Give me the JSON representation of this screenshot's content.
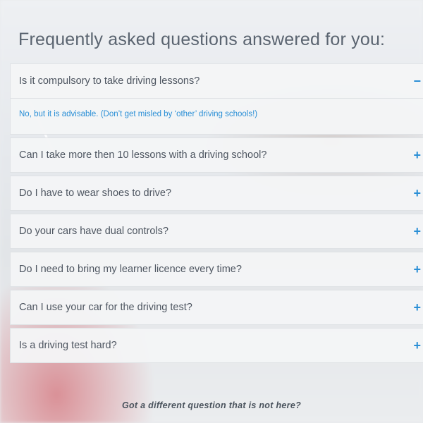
{
  "faq": {
    "title": "Frequently asked questions answered for you:",
    "items": [
      {
        "question": "Is it compulsory to take driving lessons?",
        "toggle": "−",
        "expanded": true,
        "answer": "No, but it is advisable. (Don’t get misled by ‘other’ driving schools!)"
      },
      {
        "question": "Can I take more then 10 lessons with a driving school?",
        "toggle": "+",
        "expanded": false
      },
      {
        "question": "Do I have to wear shoes to drive?",
        "toggle": "+",
        "expanded": false
      },
      {
        "question": "Do your cars have dual controls?",
        "toggle": "+",
        "expanded": false
      },
      {
        "question": "Do I need to bring my learner licence every time?",
        "toggle": "+",
        "expanded": false
      },
      {
        "question": "Can I use your car for the driving test?",
        "toggle": "+",
        "expanded": false
      },
      {
        "question": "Is a driving test hard?",
        "toggle": "+",
        "expanded": false
      }
    ],
    "footer_text": "Got a different question that is not here?"
  },
  "colors": {
    "accent": "#2a8fd6",
    "text": "#4d5560",
    "title": "#5a6470"
  }
}
